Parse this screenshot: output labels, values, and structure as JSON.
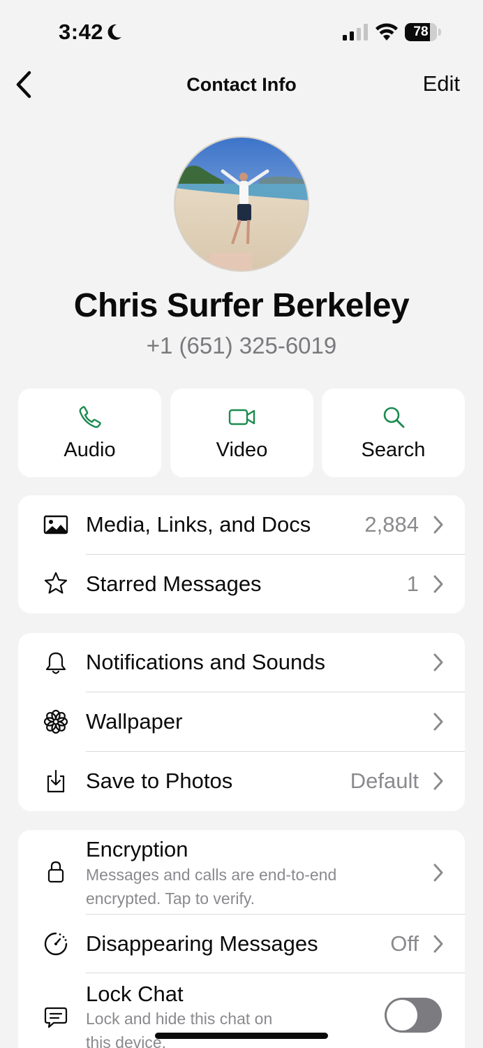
{
  "status_bar": {
    "time": "3:42",
    "battery_percent": 78,
    "battery_text": "78",
    "icons": [
      "moon-icon",
      "signal-icon",
      "wifi-icon",
      "battery-icon"
    ]
  },
  "nav": {
    "back_icon": "chevron-left-icon",
    "title": "Contact Info",
    "edit_label": "Edit"
  },
  "profile": {
    "name": "Chris Surfer Berkeley",
    "phone": "+1 (651) 325-6019"
  },
  "actions": [
    {
      "label": "Audio",
      "icon": "phone-icon"
    },
    {
      "label": "Video",
      "icon": "video-camera-icon"
    },
    {
      "label": "Search",
      "icon": "search-icon"
    }
  ],
  "section_media": {
    "media": {
      "label": "Media, Links, and Docs",
      "value": "2,884",
      "icon": "photo-icon"
    },
    "starred": {
      "label": "Starred Messages",
      "value": "1",
      "icon": "star-icon"
    }
  },
  "section_settings": {
    "notifications": {
      "label": "Notifications and Sounds",
      "icon": "bell-icon"
    },
    "wallpaper": {
      "label": "Wallpaper",
      "icon": "flower-icon"
    },
    "save_photos": {
      "label": "Save to Photos",
      "value": "Default",
      "icon": "download-icon"
    }
  },
  "section_privacy": {
    "encryption": {
      "label": "Encryption",
      "sub_line1": "Messages and calls are end-to-end",
      "sub_line2": "encrypted. Tap to verify.",
      "icon": "lock-icon"
    },
    "disappearing": {
      "label": "Disappearing Messages",
      "value": "Off",
      "icon": "timer-icon"
    },
    "lock_chat": {
      "label": "Lock Chat",
      "sub_line1": "Lock and hide this chat on",
      "sub_line2": "this device.",
      "toggle_on": false,
      "icon": "chat-lock-icon"
    }
  },
  "colors": {
    "accent_green": "#1a8a4f",
    "background": "#f3f3f3",
    "card": "#ffffff",
    "secondary_text": "#8a8a8e"
  }
}
